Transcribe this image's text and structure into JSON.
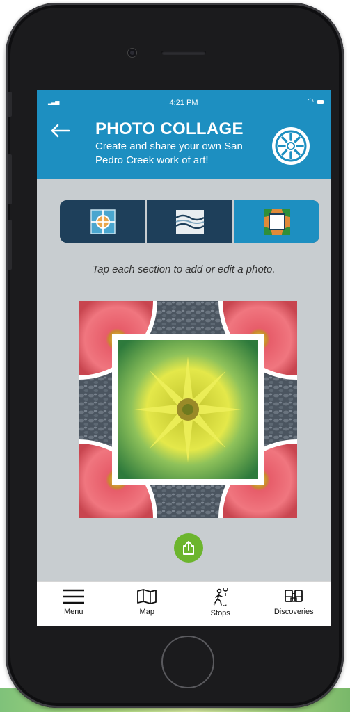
{
  "status": {
    "time": "4:21 PM"
  },
  "header": {
    "title": "PHOTO COLLAGE",
    "subtitle": "Create and share your own San Pedro Creek work of art!",
    "back_icon": "arrow-left-icon",
    "logo_icon": "creek-logo-icon"
  },
  "layout_tabs": [
    {
      "icon": "circle-layout-icon",
      "selected": false
    },
    {
      "icon": "wave-layout-icon",
      "selected": false
    },
    {
      "icon": "frame-layout-icon",
      "selected": true
    }
  ],
  "instruction": "Tap each section to add or edit a photo.",
  "share_icon": "share-icon",
  "tabbar": {
    "items": [
      {
        "label": "Menu",
        "icon": "hamburger-icon"
      },
      {
        "label": "Map",
        "icon": "map-icon"
      },
      {
        "label": "Stops",
        "icon": "hiker-icon"
      },
      {
        "label": "Discoveries",
        "icon": "binoculars-icon"
      }
    ]
  },
  "colors": {
    "header_blue": "#1d8fc1",
    "tab_dark": "#1e3f5a",
    "share_green": "#6cb52d",
    "screen_bg": "#c8cdd0"
  }
}
